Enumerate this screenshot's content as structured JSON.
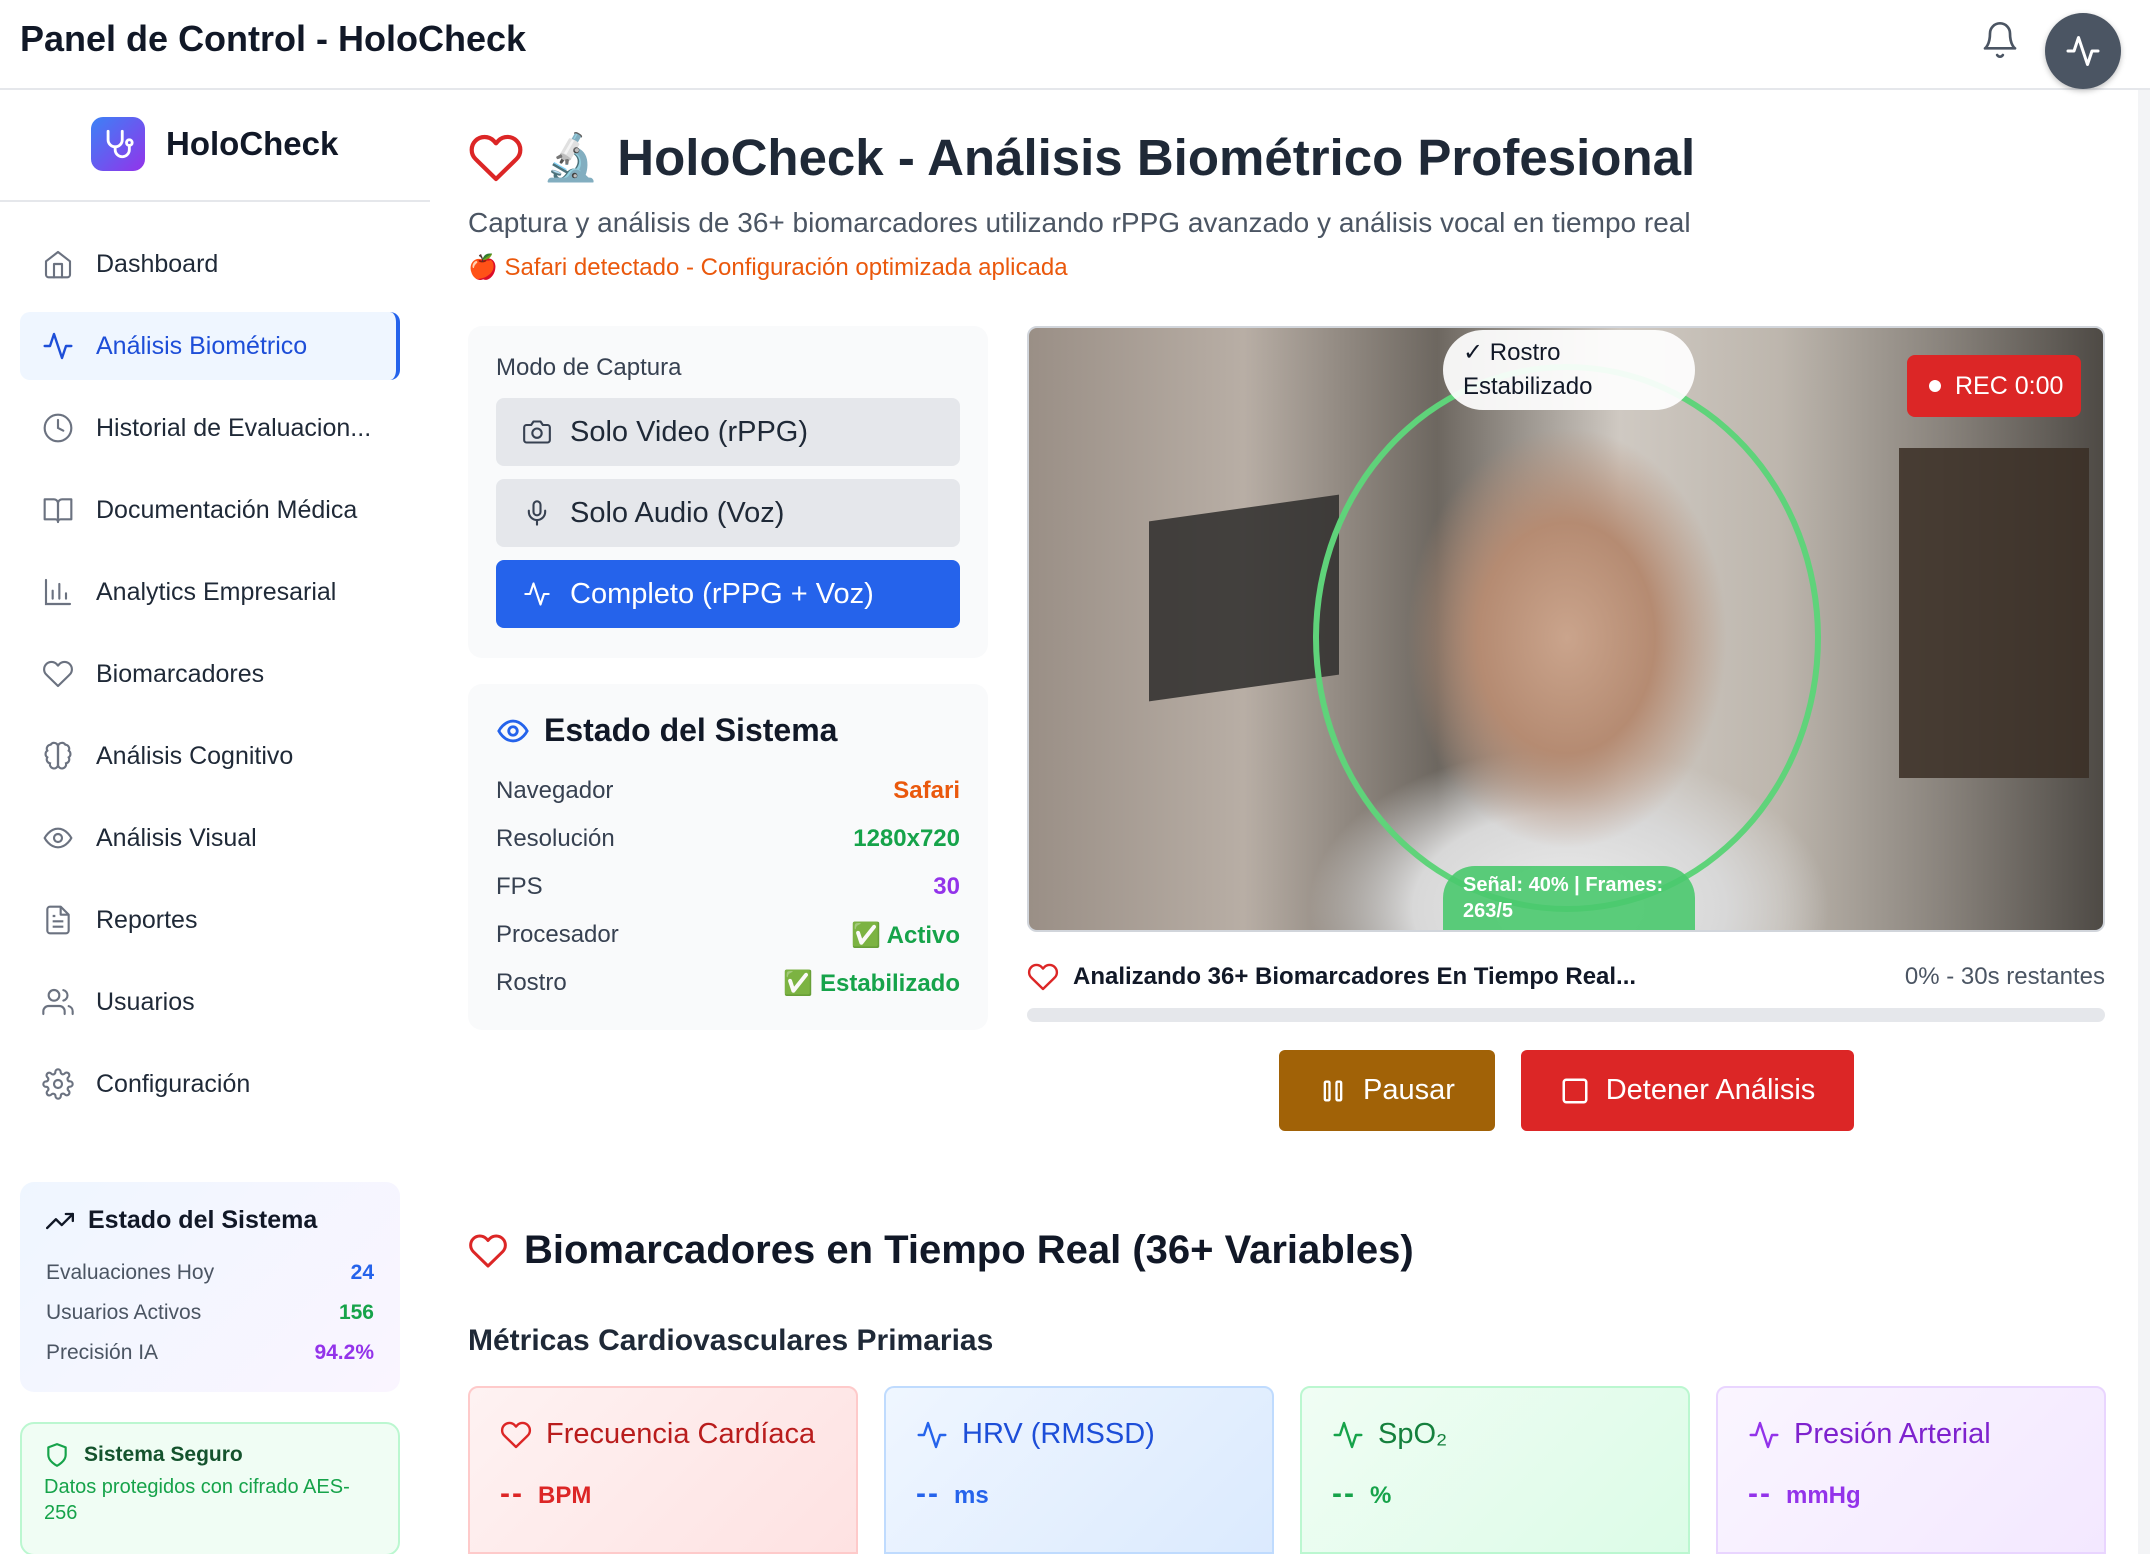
{
  "header": {
    "title": "Panel de Control - HoloCheck"
  },
  "sidebar": {
    "brand": "HoloCheck",
    "items": [
      {
        "label": "Dashboard",
        "icon": "home-icon"
      },
      {
        "label": "Análisis Biométrico",
        "icon": "activity-icon",
        "active": true
      },
      {
        "label": "Historial de Evaluacion...",
        "icon": "clock-icon"
      },
      {
        "label": "Documentación Médica",
        "icon": "book-icon"
      },
      {
        "label": "Analytics Empresarial",
        "icon": "bar-chart-icon"
      },
      {
        "label": "Biomarcadores",
        "icon": "heart-icon"
      },
      {
        "label": "Análisis Cognitivo",
        "icon": "brain-icon"
      },
      {
        "label": "Análisis Visual",
        "icon": "eye-icon"
      },
      {
        "label": "Reportes",
        "icon": "file-icon"
      },
      {
        "label": "Usuarios",
        "icon": "users-icon"
      },
      {
        "label": "Configuración",
        "icon": "gear-icon"
      }
    ],
    "system": {
      "title": "Estado del Sistema",
      "rows": [
        {
          "label": "Evaluaciones Hoy",
          "value": "24",
          "color": "#2563eb"
        },
        {
          "label": "Usuarios Activos",
          "value": "156",
          "color": "#16a34a"
        },
        {
          "label": "Precisión IA",
          "value": "94.2%",
          "color": "#9333ea"
        }
      ]
    },
    "secure": {
      "title": "Sistema Seguro",
      "text": "Datos protegidos con cifrado AES-256"
    }
  },
  "main": {
    "title_emoji": "🔬",
    "title": "HoloCheck - Análisis Biométrico Profesional",
    "subtitle": "Captura y análisis de 36+ biomarcadores utilizando rPPG avanzado y análisis vocal en tiempo real",
    "browser_notice": "🍎 Safari detectado - Configuración optimizada aplicada",
    "capture": {
      "label": "Modo de Captura",
      "modes": [
        {
          "label": "Solo Video (rPPG)",
          "icon": "camera-icon"
        },
        {
          "label": "Solo Audio (Voz)",
          "icon": "mic-icon"
        },
        {
          "label": "Completo (rPPG + Voz)",
          "icon": "activity-icon",
          "selected": true
        }
      ]
    },
    "status": {
      "title": "Estado del Sistema",
      "rows": [
        {
          "label": "Navegador",
          "value": "Safari",
          "color": "#ea580c"
        },
        {
          "label": "Resolución",
          "value": "1280x720",
          "color": "#16a34a"
        },
        {
          "label": "FPS",
          "value": "30",
          "color": "#9333ea"
        },
        {
          "label": "Procesador",
          "value": "✅ Activo",
          "color": "#16a34a"
        },
        {
          "label": "Rostro",
          "value": "✅ Estabilizado",
          "color": "#16a34a"
        }
      ]
    },
    "video": {
      "face_tag": "✓ Rostro Estabilizado",
      "rec": "REC 0:00",
      "signal": "Señal: 40% | Frames: 263/5"
    },
    "progress": {
      "label": "Analizando 36+ Biomarcadores En Tiempo Real...",
      "right": "0% - 30s restantes",
      "fraction": 0
    },
    "buttons": {
      "pause": "Pausar",
      "stop": "Detener Análisis"
    },
    "biomarkers_title": "Biomarcadores en Tiempo Real (36+ Variables)",
    "cardio_title": "Métricas Cardiovasculares Primarias",
    "metrics": [
      {
        "label": "Frecuencia Cardíaca",
        "value": "--",
        "unit": "BPM",
        "icon": "heart-icon"
      },
      {
        "label": "HRV (RMSSD)",
        "value": "--",
        "unit": "ms",
        "icon": "activity-icon"
      },
      {
        "label": "SpO₂",
        "value": "--",
        "unit": "%",
        "icon": "activity-icon"
      },
      {
        "label": "Presión Arterial",
        "value": "--",
        "unit": "mmHg",
        "icon": "activity-icon"
      }
    ]
  }
}
